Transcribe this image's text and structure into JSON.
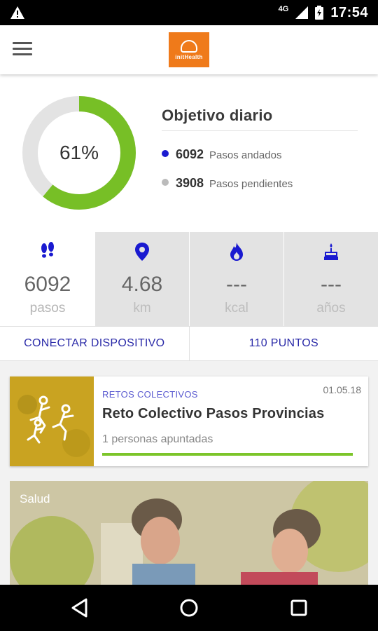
{
  "status_bar": {
    "network": "4G",
    "time": "17:54"
  },
  "app": {
    "logo_text": "initHealth"
  },
  "goal": {
    "title": "Objetivo diario",
    "percent_label": "61%",
    "progress_fraction": 0.61,
    "rows": [
      {
        "value": "6092",
        "label": "Pasos andados",
        "color": "#1a1ad0"
      },
      {
        "value": "3908",
        "label": "Pasos pendientes",
        "color": "#bbbbbb"
      }
    ],
    "colors": {
      "done": "#77bf26",
      "remaining": "#e3e3e3"
    }
  },
  "stats": [
    {
      "icon": "footsteps-icon",
      "value": "6092",
      "unit": "pasos"
    },
    {
      "icon": "location-pin-icon",
      "value": "4.68",
      "unit": "km"
    },
    {
      "icon": "flame-icon",
      "value": "---",
      "unit": "kcal"
    },
    {
      "icon": "cake-icon",
      "value": "---",
      "unit": "años"
    }
  ],
  "actions": {
    "connect": "CONECTAR DISPOSITIVO",
    "points": "110 PUNTOS"
  },
  "challenge": {
    "category": "RETOS COLECTIVOS",
    "date": "01.05.18",
    "title": "Reto Colectivo Pasos Provincias",
    "subtitle": "1 personas apuntadas",
    "progress_fraction": 1.0
  },
  "health_card": {
    "label": "Salud"
  },
  "accent_color": "#2a2aa8"
}
